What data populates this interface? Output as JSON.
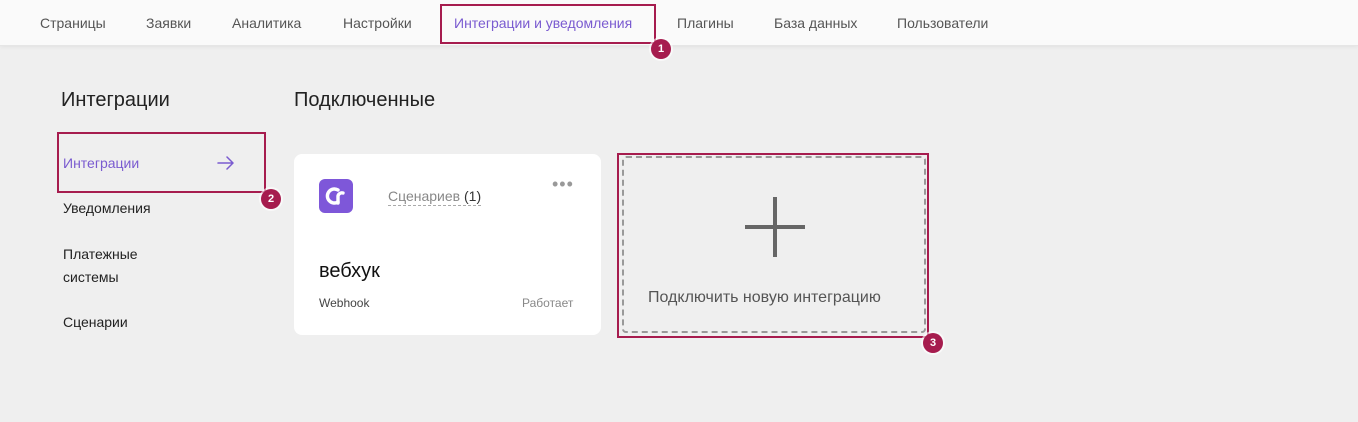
{
  "topnav": {
    "tabs": [
      {
        "label": "Страницы"
      },
      {
        "label": "Заявки"
      },
      {
        "label": "Аналитика"
      },
      {
        "label": "Настройки"
      },
      {
        "label": "Интеграции и уведомления",
        "active": true
      },
      {
        "label": "Плагины"
      },
      {
        "label": "База данных"
      },
      {
        "label": "Пользователи"
      }
    ]
  },
  "sidebar": {
    "title": "Интеграции",
    "items": [
      {
        "label": "Интеграции",
        "active": true
      },
      {
        "label": "Уведомления"
      },
      {
        "label": "Платежные системы"
      },
      {
        "label": "Сценарии"
      }
    ]
  },
  "main": {
    "title": "Подключенные",
    "integration_card": {
      "scenarios_label": "Сценариев",
      "scenarios_count": "(1)",
      "more_label": "•••",
      "name": "вебхук",
      "type": "Webhook",
      "status": "Работает"
    },
    "add_tile": {
      "label": "Подключить новую интеграцию"
    }
  },
  "callouts": [
    "1",
    "2",
    "3"
  ],
  "colors": {
    "accent": "#7a5bd0",
    "logo_bg": "#7e57d9",
    "callout": "#a61c4e",
    "page_bg": "#efefef"
  }
}
